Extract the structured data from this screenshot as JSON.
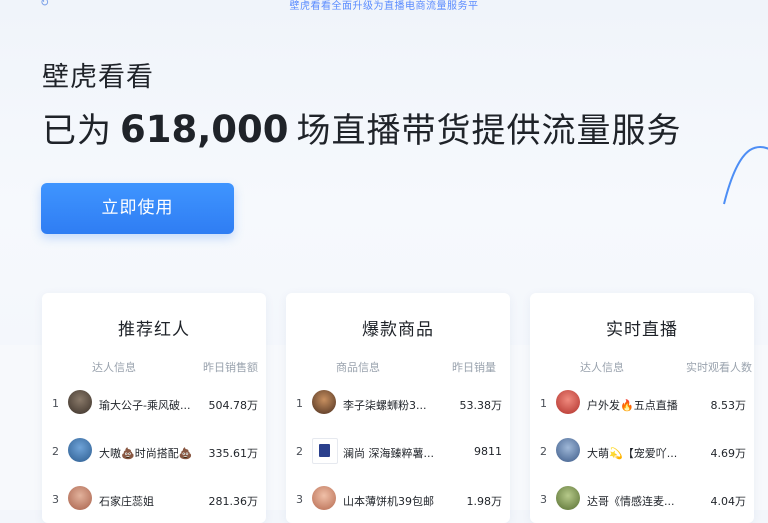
{
  "banner": {
    "text": "壁虎看看全面升级为直播电商流量服务平"
  },
  "hero": {
    "brand": "壁虎看看",
    "headline_prefix": "已为",
    "headline_number": "618,000",
    "headline_suffix": "场直播带货提供流量服务",
    "cta_label": "立即使用"
  },
  "cards": [
    {
      "title": "推荐红人",
      "col_left": "达人信息",
      "col_right": "昨日销售额",
      "rows": [
        {
          "rank": "1",
          "name": "瑜大公子-乘风破...",
          "value": "504.78万",
          "avatar": "#4a4036"
        },
        {
          "rank": "2",
          "name": "大嗷💩时尚搭配💩",
          "value": "335.61万",
          "avatar": "#3d78b5"
        },
        {
          "rank": "3",
          "name": "石家庄蕊姐",
          "value": "281.36万",
          "avatar": "#c97e62"
        }
      ]
    },
    {
      "title": "爆款商品",
      "col_left": "商品信息",
      "col_right": "昨日销量",
      "rows": [
        {
          "rank": "1",
          "name": "李子柒螺蛳粉3...",
          "value": "53.38万",
          "avatar": "#5a3b2a"
        },
        {
          "rank": "2",
          "name": "澜尚 深海臻粹薯...",
          "value": "9811",
          "avatar": "#2a3f8c"
        },
        {
          "rank": "3",
          "name": "山本薄饼机39包邮",
          "value": "1.98万",
          "avatar": "#b5694f"
        }
      ]
    },
    {
      "title": "实时直播",
      "col_left": "达人信息",
      "col_right": "实时观看人数",
      "rows": [
        {
          "rank": "1",
          "name": "户外发🔥五点直播",
          "value": "8.53万",
          "avatar": "#c8433a"
        },
        {
          "rank": "2",
          "name": "大萌💫【宠爱吖...",
          "value": "4.69万",
          "avatar": "#4b6fa0"
        },
        {
          "rank": "3",
          "name": "达哥《情感连麦...",
          "value": "4.04万",
          "avatar": "#6b8a3f"
        }
      ]
    }
  ]
}
